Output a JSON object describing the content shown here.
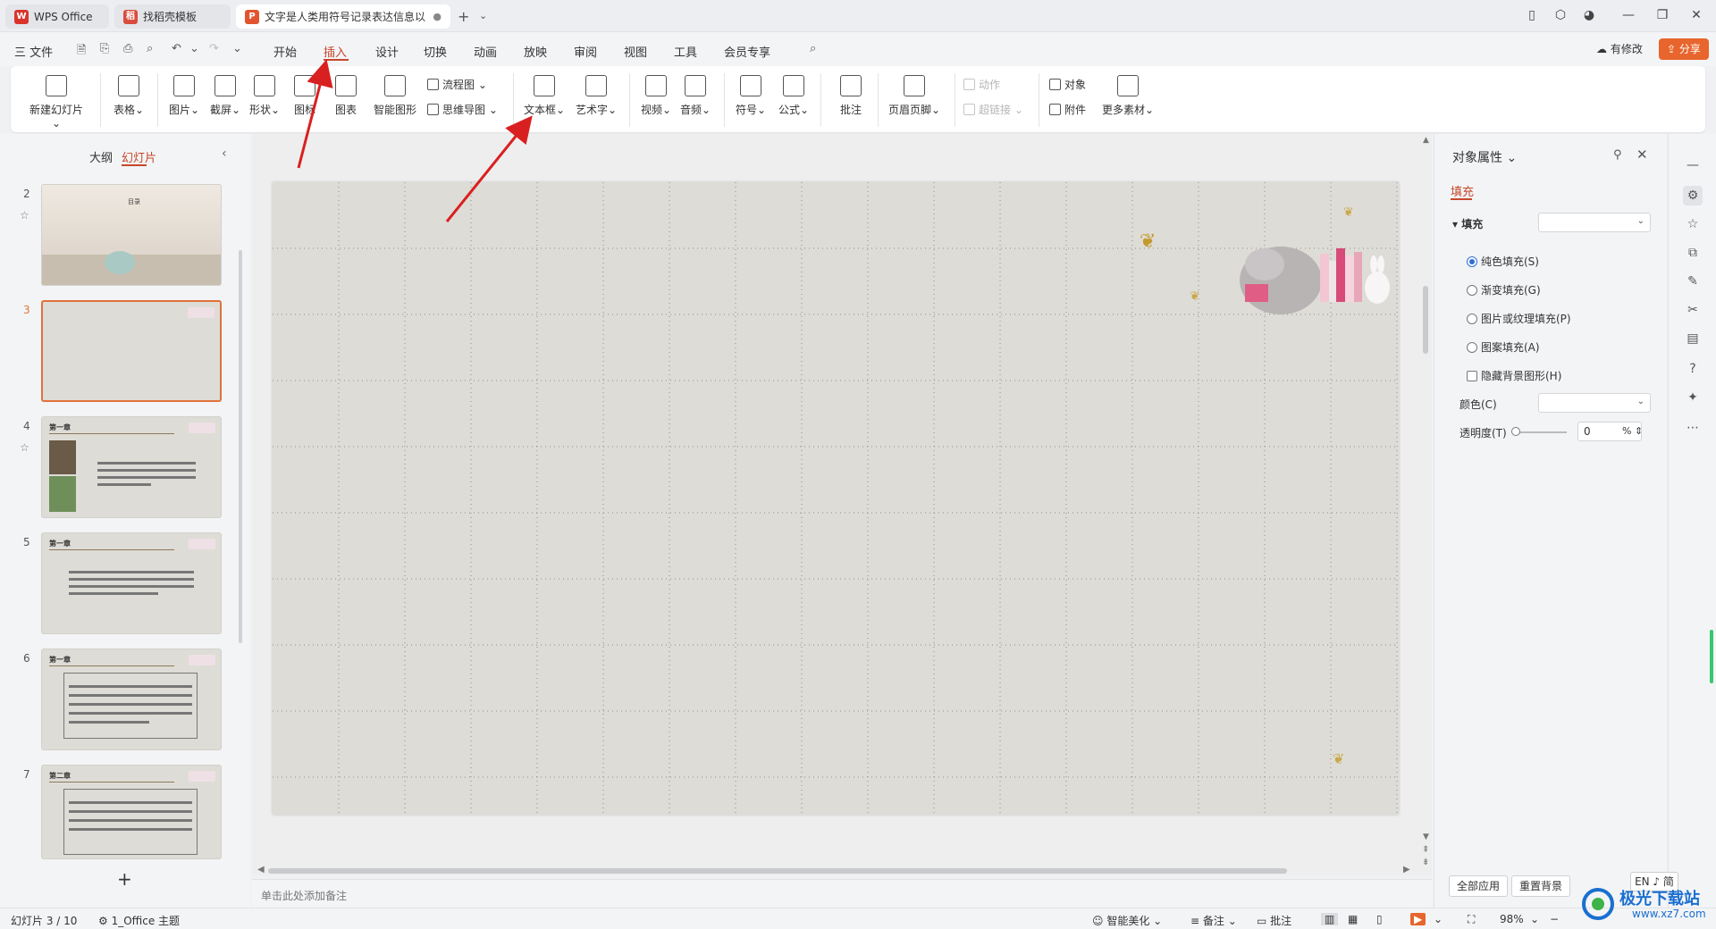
{
  "titlebar": {
    "tabs": [
      {
        "label": "WPS Office"
      },
      {
        "label": "找稻壳模板"
      },
      {
        "label": "文字是人类用符号记录表达信息以"
      }
    ]
  },
  "menubar": {
    "file": "三 文件",
    "items": [
      "开始",
      "插入",
      "设计",
      "切换",
      "动画",
      "放映",
      "审阅",
      "视图",
      "工具",
      "会员专享"
    ],
    "active": "插入",
    "has_changes": "有修改",
    "share": "分享"
  },
  "ribbon": {
    "new_slide": "新建幻灯片",
    "table": "表格",
    "picture": "图片",
    "screenshot": "截屏",
    "shape": "形状",
    "icon": "图标",
    "chart": "图表",
    "smart_graphic": "智能图形",
    "flowchart": "流程图",
    "mind_map": "思维导图",
    "textbox": "文本框",
    "art_text": "艺术字",
    "video": "视频",
    "audio": "音频",
    "symbol": "符号",
    "formula": "公式",
    "comment": "批注",
    "header_footer": "页眉页脚",
    "action": "动作",
    "hyperlink": "超链接",
    "object": "对象",
    "attachment": "附件",
    "more_materials": "更多素材"
  },
  "left_panel": {
    "tab_outline": "大纲",
    "tab_slides": "幻灯片",
    "slides": [
      {
        "num": "2",
        "starred": true
      },
      {
        "num": "3",
        "selected": true
      },
      {
        "num": "4",
        "starred": true,
        "chapter": "第一章"
      },
      {
        "num": "5",
        "chapter": "第一章"
      },
      {
        "num": "6",
        "chapter": "第一章"
      },
      {
        "num": "7",
        "chapter": "第二章"
      }
    ],
    "slide2_title": "目录"
  },
  "notes": {
    "placeholder": "单击此处添加备注"
  },
  "right_panel": {
    "title": "对象属性",
    "tab_fill": "填充",
    "fill_label": "填充",
    "options": [
      {
        "label": "纯色填充(S)",
        "checked": true
      },
      {
        "label": "渐变填充(G)",
        "checked": false
      },
      {
        "label": "图片或纹理填充(P)",
        "checked": false
      },
      {
        "label": "图案填充(A)",
        "checked": false
      }
    ],
    "hide_bg": "隐藏背景图形(H)",
    "color_label": "颜色(C)",
    "transparency_label": "透明度(T)",
    "transparency_value": "0",
    "transparency_unit": "%",
    "apply_all": "全部应用",
    "reset_bg": "重置背景"
  },
  "statusbar": {
    "slide_info": "幻灯片 3 / 10",
    "theme": "1_Office 主题",
    "smart_beautify": "智能美化",
    "notes": "备注",
    "comment": "批注",
    "zoom": "98%"
  },
  "ime": "EN ♪ 简",
  "watermark": {
    "text": "极光下载站",
    "url": "www.xz7.com"
  }
}
